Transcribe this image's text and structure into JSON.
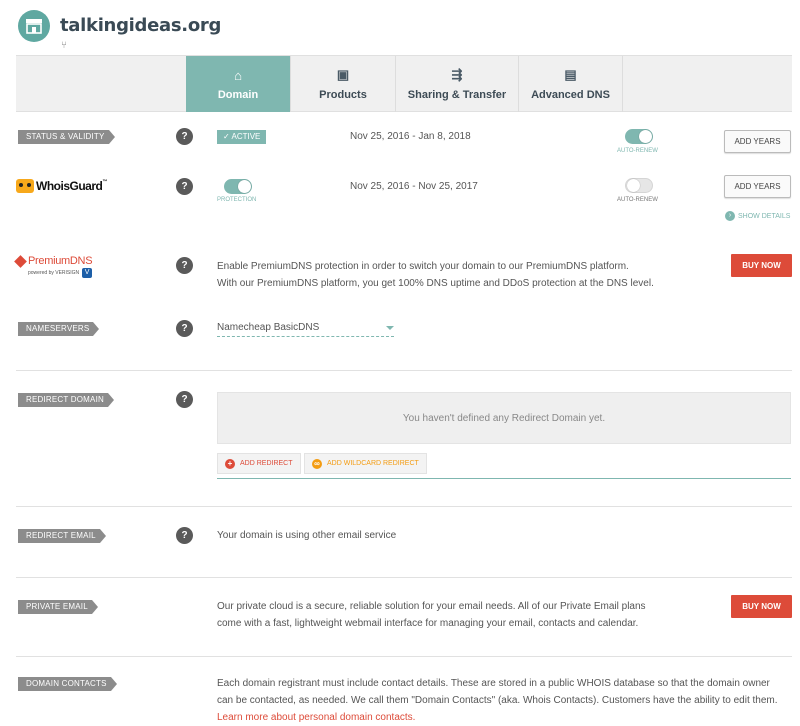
{
  "header": {
    "title": "talkingideas.org",
    "site_icon": "store-icon",
    "sub_icon": "fork-icon"
  },
  "tabs": [
    {
      "label": "Domain",
      "icon": "home-icon",
      "active": true
    },
    {
      "label": "Products",
      "icon": "box-icon",
      "active": false
    },
    {
      "label": "Sharing & Transfer",
      "icon": "transfer-truck-icon",
      "active": false
    },
    {
      "label": "Advanced DNS",
      "icon": "server-icon",
      "active": false
    }
  ],
  "status": {
    "label": "STATUS & VALIDITY",
    "badge": "ACTIVE",
    "dates": "Nov 25, 2016 - Jan 8, 2018",
    "auto_renew_label": "AUTO-RENEW",
    "auto_renew_on": true,
    "button": "ADD YEARS"
  },
  "whoisguard": {
    "logo_text": "WhoisGuard",
    "logo_tm": "™",
    "protection_label": "PROTECTION",
    "protection_on": true,
    "dates": "Nov 25, 2016 - Nov 25, 2017",
    "auto_renew_label": "AUTO-RENEW",
    "auto_renew_on": false,
    "button": "ADD YEARS",
    "show_details": "SHOW DETAILS"
  },
  "premiumdns": {
    "logo_text": "PremiumDNS",
    "powered_by": "powered by VERISIGN",
    "line1": "Enable PremiumDNS protection in order to switch your domain to our PremiumDNS platform.",
    "line2": "With our PremiumDNS platform, you get 100% DNS uptime and DDoS protection at the DNS level.",
    "button": "BUY NOW"
  },
  "nameservers": {
    "label": "NAMESERVERS",
    "value": "Namecheap BasicDNS"
  },
  "redirect_domain": {
    "label": "REDIRECT DOMAIN",
    "empty_text": "You haven't defined any Redirect Domain yet.",
    "add_redirect": "ADD REDIRECT",
    "add_wildcard": "ADD WILDCARD REDIRECT"
  },
  "redirect_email": {
    "label": "REDIRECT EMAIL",
    "text": "Your domain is using other email service"
  },
  "private_email": {
    "label": "PRIVATE EMAIL",
    "line1": "Our private cloud is a secure, reliable solution for your email needs. All of our Private Email plans",
    "line2": "come with a fast, lightweight webmail interface for managing your email, contacts and calendar.",
    "button": "BUY NOW"
  },
  "domain_contacts": {
    "label": "DOMAIN CONTACTS",
    "line1": "Each domain registrant must include contact details. These are stored in a public WHOIS database so that the domain owner",
    "line2": "can be contacted, as needed. We call them \"Domain Contacts\" (aka. Whois Contacts). Customers have the ability to edit them.",
    "link": "Learn more about personal domain contacts."
  },
  "colors": {
    "accent": "#7fb7b0",
    "buy_red": "#dd4b39",
    "label_grey": "#8c8c8c"
  }
}
